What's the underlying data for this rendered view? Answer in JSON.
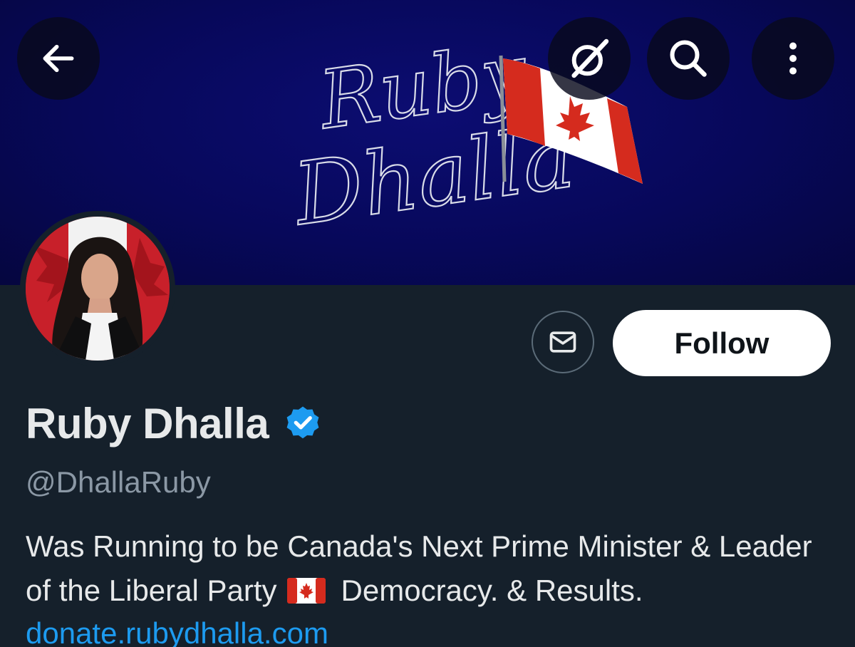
{
  "header": {
    "back_icon": "arrow-left-icon",
    "grok_icon": "grok-icon",
    "search_icon": "search-icon",
    "more_icon": "more-vertical-icon"
  },
  "banner": {
    "script_line1": "Ruby",
    "script_line2": "Dhalla"
  },
  "profile": {
    "display_name": "Ruby Dhalla",
    "verified": true,
    "handle": "@DhallaRuby",
    "bio_part1": "Was Running to be Canada's Next Prime Minister & Leader of the Liberal Party",
    "bio_flag": "🇨🇦",
    "bio_part2": "Democracy. & Results.",
    "link": "donate.rubydhalla.com"
  },
  "actions": {
    "message_icon": "envelope-icon",
    "follow_label": "Follow"
  },
  "colors": {
    "background": "#15202b",
    "banner": "#07085a",
    "accent": "#1d9bf0",
    "text_primary": "#e7e9ea",
    "text_secondary": "#8b98a5"
  }
}
